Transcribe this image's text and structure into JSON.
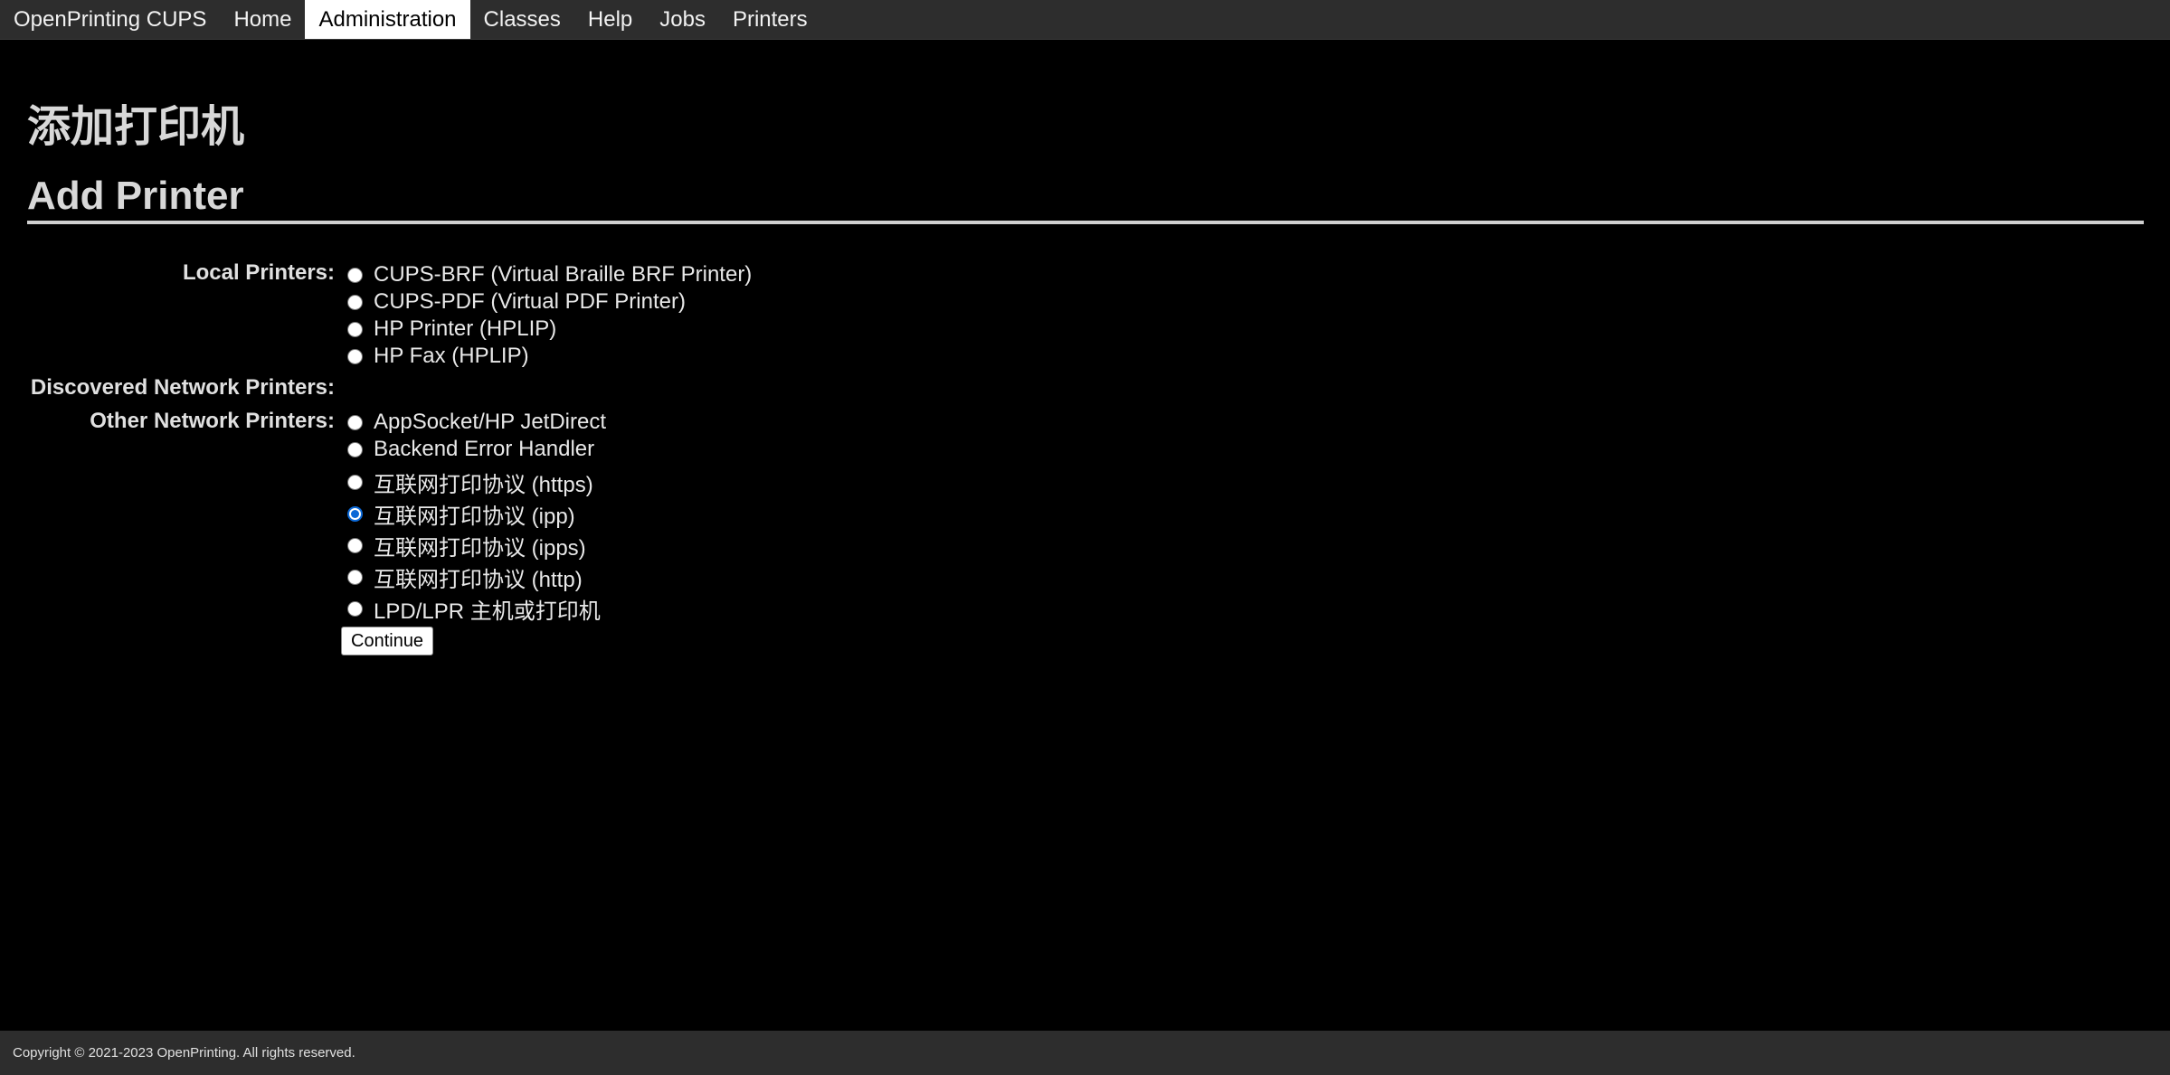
{
  "nav": {
    "brand": "OpenPrinting CUPS",
    "items": [
      "Home",
      "Administration",
      "Classes",
      "Help",
      "Jobs",
      "Printers"
    ],
    "active": "Administration"
  },
  "page": {
    "title_cn": "添加打印机",
    "title_en": "Add Printer"
  },
  "form": {
    "local_label": "Local Printers:",
    "discovered_label": "Discovered Network Printers:",
    "other_label": "Other Network Printers:",
    "local_printers": [
      "CUPS-BRF (Virtual Braille BRF Printer)",
      "CUPS-PDF (Virtual PDF Printer)",
      "HP Printer (HPLIP)",
      "HP Fax (HPLIP)"
    ],
    "other_printers": [
      "AppSocket/HP JetDirect",
      "Backend Error Handler",
      "互联网打印协议 (https)",
      "互联网打印协议 (ipp)",
      "互联网打印协议 (ipps)",
      "互联网打印协议 (http)",
      "LPD/LPR 主机或打印机"
    ],
    "selected": "互联网打印协议 (ipp)",
    "continue_label": "Continue"
  },
  "footer": {
    "text": "Copyright © 2021-2023 OpenPrinting. All rights reserved."
  },
  "colors": {
    "background": "#000000",
    "nav_bg": "#2d2d2d",
    "radio_checked": "#0b68d6"
  }
}
